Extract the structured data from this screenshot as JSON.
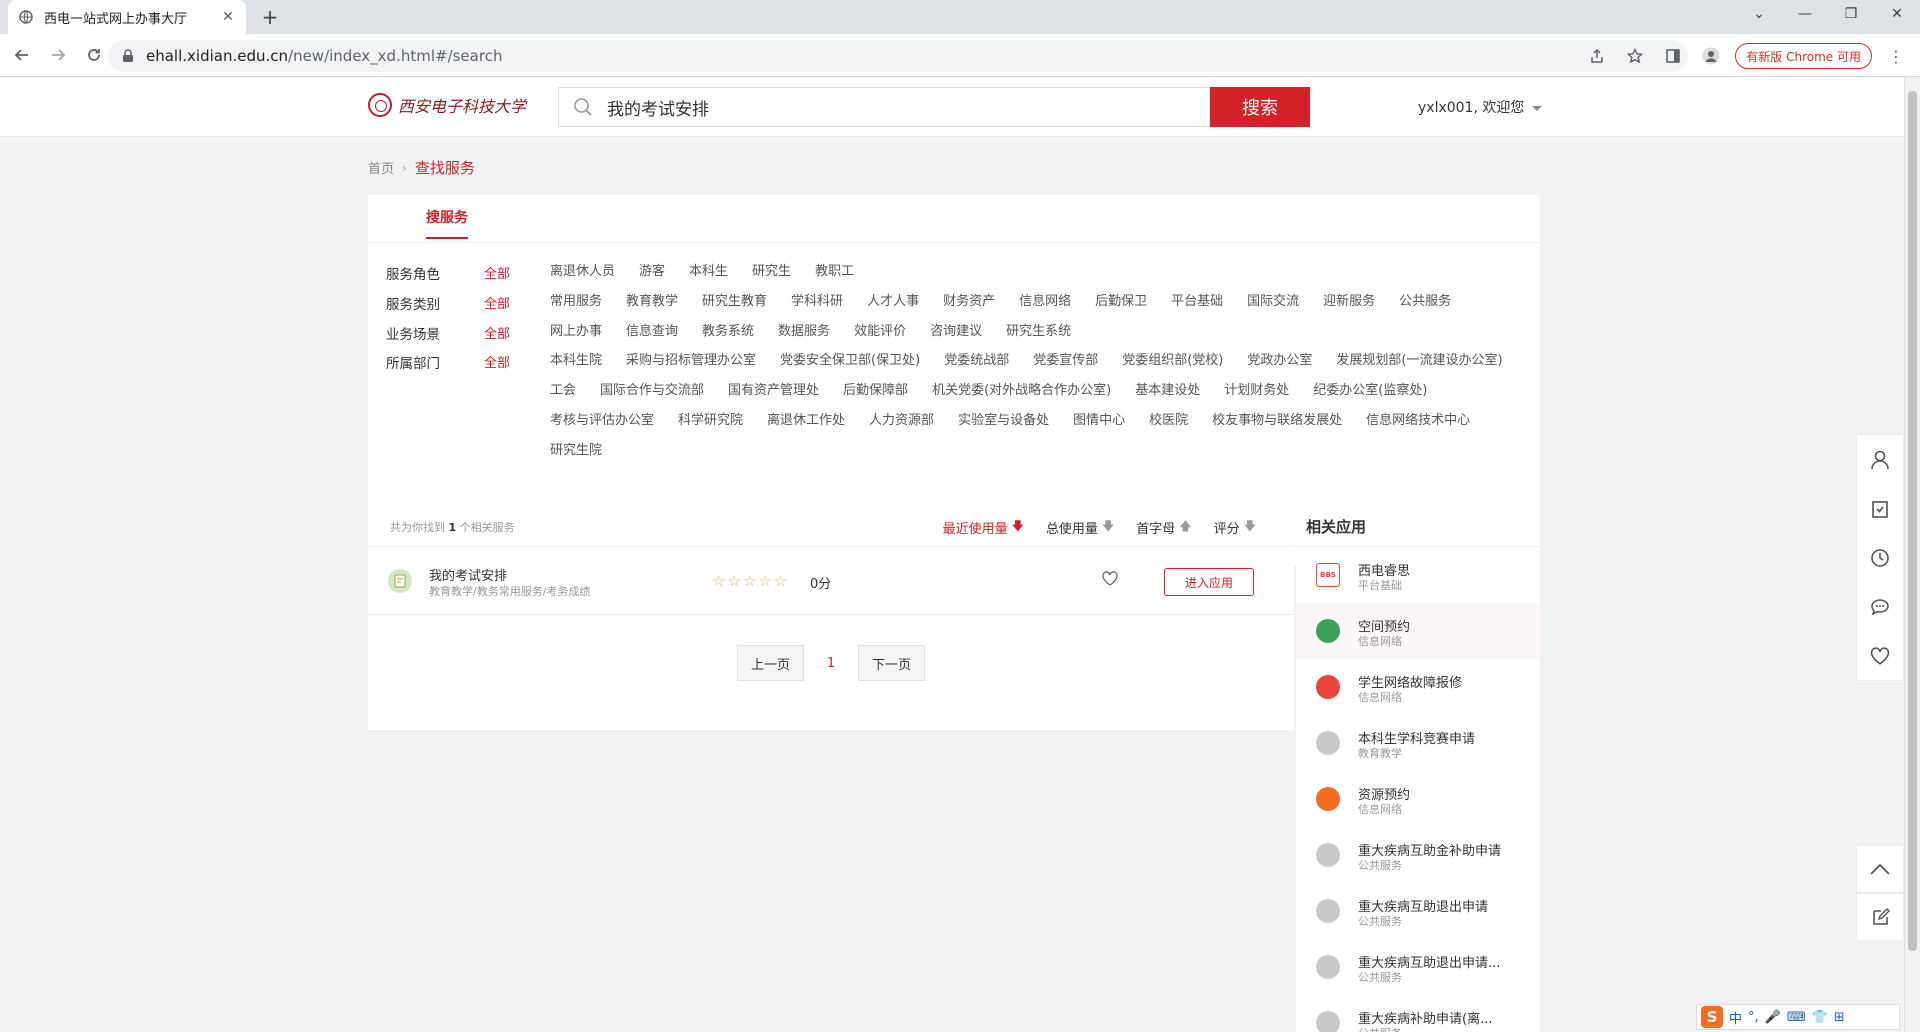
{
  "browser": {
    "tab_title": "西电一站式网上办事大厅",
    "url_host": "ehall.xidian.edu.cn",
    "url_path": "/new/index_xd.html#/search",
    "update_label": "有新版 Chrome 可用"
  },
  "header": {
    "logo_text": "西安电子科技大学",
    "search_value": "我的考试安排",
    "search_button": "搜索",
    "user_greeting": "yxlx001, 欢迎您"
  },
  "breadcrumb": {
    "home": "首页",
    "current": "查找服务"
  },
  "tabs": {
    "search_services": "搜服务"
  },
  "filters": {
    "all_label": "全部",
    "role": {
      "label": "服务角色",
      "items": [
        "离退休人员",
        "游客",
        "本科生",
        "研究生",
        "教职工"
      ]
    },
    "category": {
      "label": "服务类别",
      "items": [
        "常用服务",
        "教育教学",
        "研究生教育",
        "学科科研",
        "人才人事",
        "财务资产",
        "信息网络",
        "后勤保卫",
        "平台基础",
        "国际交流",
        "迎新服务",
        "公共服务"
      ]
    },
    "scene": {
      "label": "业务场景",
      "items": [
        "网上办事",
        "信息查询",
        "教务系统",
        "数据服务",
        "效能评价",
        "咨询建议",
        "研究生系统"
      ]
    },
    "department": {
      "label": "所属部门",
      "items": [
        "本科生院",
        "采购与招标管理办公室",
        "党委安全保卫部(保卫处)",
        "党委统战部",
        "党委宣传部",
        "党委组织部(党校)",
        "党政办公室",
        "发展规划部(一流建设办公室)",
        "工会",
        "国际合作与交流部",
        "国有资产管理处",
        "后勤保障部",
        "机关党委(对外战略合作办公室)",
        "基本建设处",
        "计划财务处",
        "纪委办公室(监察处)",
        "考核与评估办公室",
        "科学研究院",
        "离退休工作处",
        "人力资源部",
        "实验室与设备处",
        "图情中心",
        "校医院",
        "校友事物与联络发展处",
        "信息网络技术中心",
        "研究生院"
      ]
    }
  },
  "results": {
    "count_prefix": "共为你找到",
    "count": "1",
    "count_suffix": "个相关服务",
    "sort": [
      "最近使用量",
      "总使用量",
      "首字母",
      "评分"
    ],
    "items": [
      {
        "name": "我的考试安排",
        "path": "教育教学/教务常用服务/考务成绩",
        "score": "0分",
        "rating": 0,
        "action": "进入应用"
      }
    ],
    "pager": {
      "prev": "上一页",
      "page": "1",
      "next": "下一页"
    }
  },
  "related": {
    "title": "相关应用",
    "items": [
      {
        "name": "西电睿思",
        "category": "平台基础",
        "icon": "bbs-icon",
        "color": "#e8453c"
      },
      {
        "name": "空间预约",
        "category": "信息网络",
        "icon": "calendar-icon",
        "color": "#3aa35b"
      },
      {
        "name": "学生网络故障报修",
        "category": "信息网络",
        "icon": "wrench-icon",
        "color": "#e8453c"
      },
      {
        "name": "本科生学科竞赛申请",
        "category": "教育教学",
        "icon": "placeholder-icon",
        "color": "#c8c8c8"
      },
      {
        "name": "资源预约",
        "category": "信息网络",
        "icon": "printer-icon",
        "color": "#f26c21"
      },
      {
        "name": "重大疾病互助金补助申请",
        "category": "公共服务",
        "icon": "placeholder-icon",
        "color": "#c8c8c8"
      },
      {
        "name": "重大疾病互助退出申请",
        "category": "公共服务",
        "icon": "placeholder-icon",
        "color": "#c8c8c8"
      },
      {
        "name": "重大疾病互助退出申请...",
        "category": "公共服务",
        "icon": "placeholder-icon",
        "color": "#c8c8c8"
      },
      {
        "name": "重大疾病补助申请(离...",
        "category": "公共服务",
        "icon": "placeholder-icon",
        "color": "#c8c8c8"
      }
    ]
  },
  "ime": {
    "mode": "中"
  }
}
